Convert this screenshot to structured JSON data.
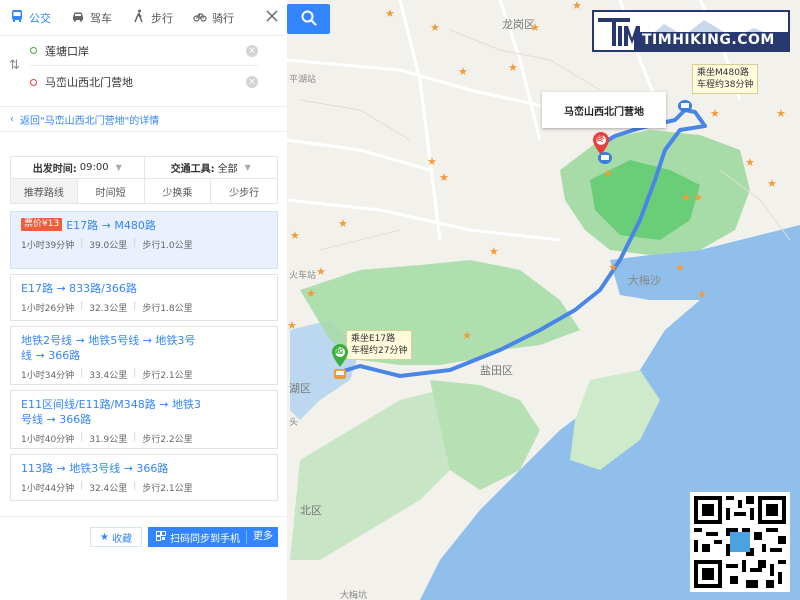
{
  "modes": [
    {
      "label": "公交",
      "icon": "bus-icon",
      "active": true
    },
    {
      "label": "驾车",
      "icon": "car-icon",
      "active": false
    },
    {
      "label": "步行",
      "icon": "walk-icon",
      "active": false
    },
    {
      "label": "骑行",
      "icon": "bike-icon",
      "active": false
    }
  ],
  "route": {
    "start": "莲塘口岸",
    "end": "马峦山西北门营地"
  },
  "back_link": "返回\"马峦山西北门营地\"的详情",
  "filters": {
    "depart_label": "出发时间:",
    "depart_value": "09:00",
    "tool_label": "交通工具:",
    "tool_value": "全部",
    "sorts": [
      "推荐路线",
      "时间短",
      "少换乘",
      "少步行"
    ]
  },
  "plans": [
    {
      "fare": "票价¥13",
      "title": "E17路 → M480路",
      "time": "1小时39分钟",
      "distance": "39.0公里",
      "walk": "步行1.0公里"
    },
    {
      "fare": "",
      "title": "E17路 → 833路/366路",
      "time": "1小时26分钟",
      "distance": "32.3公里",
      "walk": "步行1.8公里"
    },
    {
      "fare": "",
      "title": "地铁2号线 → 地铁5号线 → 地铁3号线 → 366路",
      "time": "1小时34分钟",
      "distance": "33.4公里",
      "walk": "步行2.1公里"
    },
    {
      "fare": "",
      "title": "E11区间线/E11路/M348路 → 地铁3号线 → 366路",
      "time": "1小时40分钟",
      "distance": "31.9公里",
      "walk": "步行2.2公里"
    },
    {
      "fare": "",
      "title": "113路 → 地铁3号线 → 366路",
      "time": "1小时44分钟",
      "distance": "32.4公里",
      "walk": "步行2.1公里"
    }
  ],
  "actions": {
    "favorite": "收藏",
    "sync": "扫码同步到手机",
    "more": "更多"
  },
  "map": {
    "destination_popup": "马峦山西北门营地",
    "tip_e17": [
      "乘坐E17路",
      "车程约27分钟"
    ],
    "tip_m480": [
      "乘坐M480路",
      "车程约38分钟"
    ],
    "start_marker": "起",
    "end_marker": "终",
    "labels": {
      "longgang": "龙岗区",
      "yantian": "盐田区",
      "futian_partial": "北区",
      "luohu_partial": "湖区",
      "dameisha": "大梅沙",
      "station_partial_1": "平湖站",
      "station_partial_2": "火车站",
      "shatoujiao_partial": "头",
      "bottom_partial": "大梅坑"
    },
    "colors": {
      "route": "#4a86e8",
      "sea": "#8fbfea",
      "green": "#a7dca8",
      "green_dark": "#5bc96c",
      "land": "#f3f1ec"
    }
  },
  "logo_text": "TIMHIKING.COM"
}
